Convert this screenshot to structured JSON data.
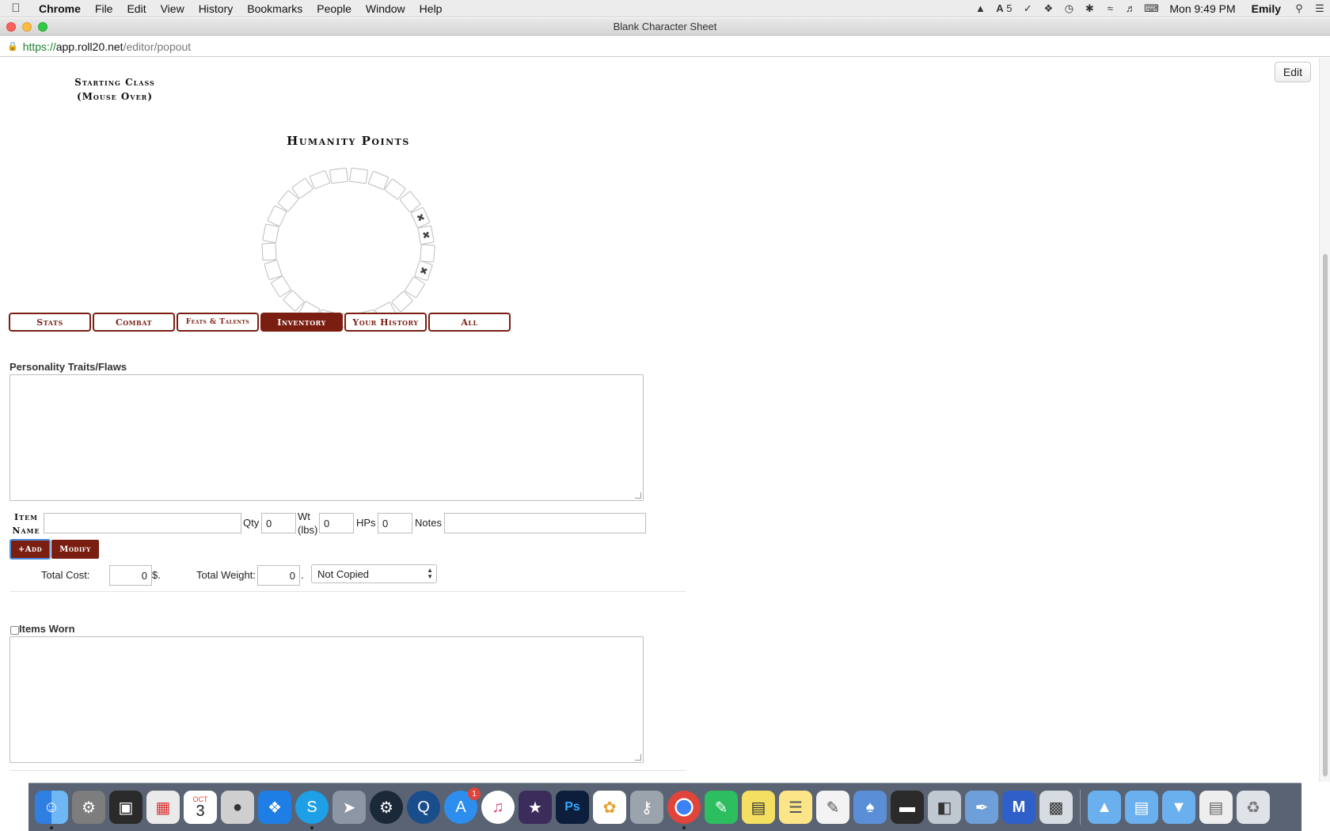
{
  "menubar": {
    "items": [
      "Chrome",
      "File",
      "Edit",
      "View",
      "History",
      "Bookmarks",
      "People",
      "Window",
      "Help"
    ],
    "adobe_count": "5",
    "clock": "Mon 9:49 PM",
    "user": "Emily"
  },
  "window": {
    "title": "Blank Character Sheet",
    "url_scheme": "https://",
    "url_domain": "app.roll20.net",
    "url_path": "/editor/popout"
  },
  "toolbar": {
    "edit_label": "Edit"
  },
  "sheet": {
    "starting_class_line1": "Starting Class",
    "starting_class_line2": "(Mouse Over)",
    "humanity_title": "Humanity Points",
    "humanity_marks": [
      "",
      "",
      "",
      "",
      "",
      "",
      "",
      "✖",
      "✖",
      "",
      "✖",
      "",
      "",
      "",
      "",
      "",
      "",
      "",
      "",
      "",
      "",
      "",
      "",
      "",
      ""
    ],
    "tabs": [
      "Stats",
      "Combat",
      "Feats & Talents",
      "Inventory",
      "Your History",
      "All"
    ],
    "active_tab": "Inventory",
    "personality_label": "Personality Traits/Flaws",
    "item_name_line1": "Item",
    "item_name_line2": "Name",
    "qty_label": "Qty",
    "qty_value": "0",
    "wt_label_line1": "Wt",
    "wt_label_line2": "(lbs)",
    "wt_value": "0",
    "hps_label": "HPs",
    "hps_value": "0",
    "notes_label": "Notes",
    "add_label": "+Add",
    "modify_label": "Modify",
    "total_cost_label": "Total Cost:",
    "total_cost_value": "0",
    "currency": "$.",
    "total_weight_label": "Total Weight:",
    "total_weight_value": "0",
    "total_weight_suffix": ".",
    "copy_select": "Not Copied",
    "items_worn_label": "Items Worn"
  },
  "dock": {
    "calendar_month": "OCT",
    "calendar_day": "3",
    "appstore_badge": "1",
    "apps": [
      "finder-icon",
      "system-preferences-icon",
      "photo-booth-icon",
      "launchpad-icon",
      "calendar-icon",
      "dvd-player-icon",
      "dropbox-icon",
      "skype-icon",
      "rocket-icon",
      "steam-icon",
      "quicktime-icon",
      "app-store-icon",
      "itunes-icon",
      "imovie-icon",
      "photoshop-icon",
      "photos-icon",
      "keychain-icon",
      "chrome-icon",
      "evernote-icon",
      "stickies-icon",
      "notes-icon",
      "textedit-icon",
      "network-icon",
      "media-icon",
      "preview-icon",
      "pen-icon",
      "malwarebytes-icon",
      "image-capture-icon"
    ],
    "folders": [
      "applications-folder-icon",
      "documents-folder-icon",
      "downloads-folder-icon",
      "document-stack-icon",
      "trash-icon"
    ]
  }
}
